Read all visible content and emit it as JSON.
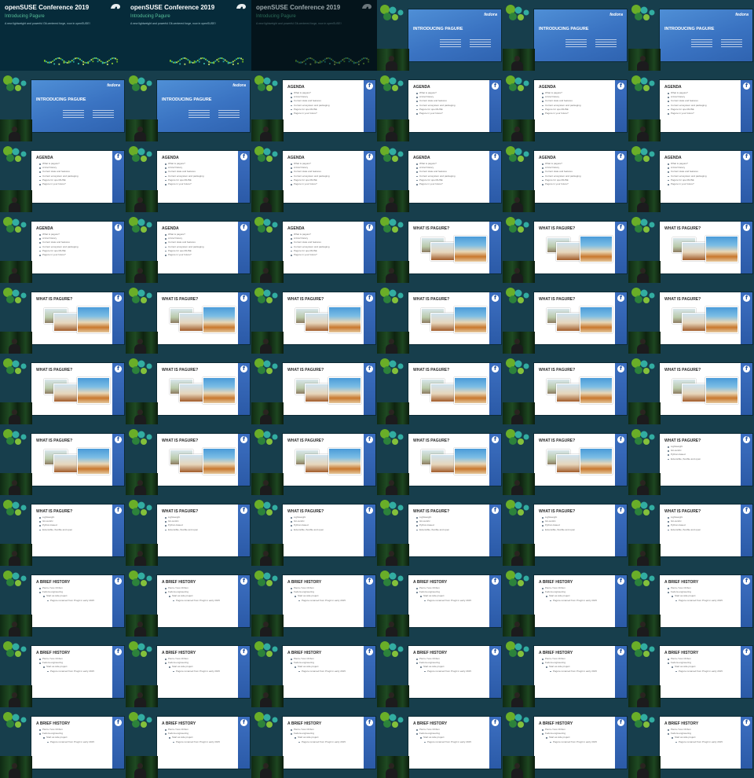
{
  "title_card": {
    "conference": "openSUSE Conference 2019",
    "talk": "Introducing Pagure",
    "description": "A new lightweight and powerful Git-centered forge, now in openSUSE!"
  },
  "slides": {
    "intro": {
      "heading": "INTRODUCING PAGURE",
      "brand": "fedora"
    },
    "agenda": {
      "heading": "AGENDA",
      "bullets": [
        "What is pagure?",
        "A brief history",
        "Current state and features",
        "Current ecosystem and packaging",
        "Pagure for openSUSE",
        "Pagure in your future?"
      ]
    },
    "what": {
      "heading": "WHAT IS PAGURE?",
      "bullets": [
        "Lightweight",
        "Git-centric",
        "Python-based",
        "Extensible, flexible and open"
      ]
    },
    "history": {
      "heading": "A BRIEF HISTORY",
      "bullets": [
        "Pierre-Yves Chibon",
        "Fedora engineering",
        "Start as side project",
        "Pagure renamed from Progit in early 2015"
      ]
    }
  },
  "frames": [
    {
      "kind": "title"
    },
    {
      "kind": "title"
    },
    {
      "kind": "title",
      "dim": true
    },
    {
      "kind": "intro"
    },
    {
      "kind": "intro"
    },
    {
      "kind": "intro"
    },
    {
      "kind": "intro"
    },
    {
      "kind": "intro"
    },
    {
      "kind": "agenda"
    },
    {
      "kind": "agenda"
    },
    {
      "kind": "agenda"
    },
    {
      "kind": "agenda"
    },
    {
      "kind": "agenda"
    },
    {
      "kind": "agenda"
    },
    {
      "kind": "agenda"
    },
    {
      "kind": "agenda"
    },
    {
      "kind": "agenda"
    },
    {
      "kind": "agenda"
    },
    {
      "kind": "agenda"
    },
    {
      "kind": "agenda"
    },
    {
      "kind": "agenda"
    },
    {
      "kind": "photos"
    },
    {
      "kind": "photos"
    },
    {
      "kind": "photos"
    },
    {
      "kind": "photos"
    },
    {
      "kind": "photos"
    },
    {
      "kind": "photos"
    },
    {
      "kind": "photos"
    },
    {
      "kind": "photos"
    },
    {
      "kind": "photos"
    },
    {
      "kind": "photos"
    },
    {
      "kind": "photos"
    },
    {
      "kind": "photos"
    },
    {
      "kind": "photos"
    },
    {
      "kind": "photos"
    },
    {
      "kind": "photos"
    },
    {
      "kind": "photos"
    },
    {
      "kind": "photos"
    },
    {
      "kind": "photos"
    },
    {
      "kind": "photos"
    },
    {
      "kind": "photos"
    },
    {
      "kind": "what"
    },
    {
      "kind": "what"
    },
    {
      "kind": "what"
    },
    {
      "kind": "what"
    },
    {
      "kind": "what"
    },
    {
      "kind": "what"
    },
    {
      "kind": "what"
    },
    {
      "kind": "history"
    },
    {
      "kind": "history"
    },
    {
      "kind": "history"
    },
    {
      "kind": "history"
    },
    {
      "kind": "history"
    },
    {
      "kind": "history"
    },
    {
      "kind": "history"
    },
    {
      "kind": "history"
    },
    {
      "kind": "history"
    },
    {
      "kind": "history"
    },
    {
      "kind": "history"
    },
    {
      "kind": "history"
    },
    {
      "kind": "history"
    },
    {
      "kind": "history"
    },
    {
      "kind": "history"
    },
    {
      "kind": "history"
    },
    {
      "kind": "history"
    },
    {
      "kind": "history"
    }
  ],
  "colors": {
    "background": "#173e4c",
    "opensuse_green": "#73ba25",
    "fedora_blue": "#3c6fc1"
  },
  "icons": [
    "opensuse-chameleon-icon",
    "conference-logo-icon",
    "fedora-logo-icon"
  ]
}
